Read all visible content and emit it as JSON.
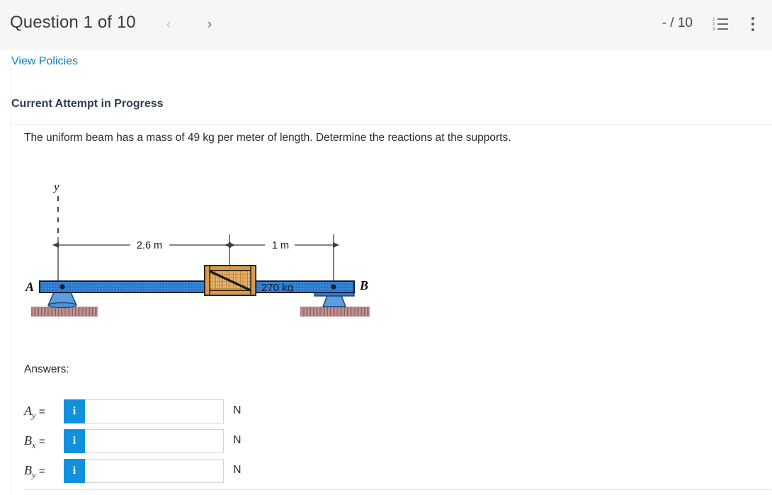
{
  "header": {
    "question_title": "Question 1 of 10",
    "prev_label": "‹",
    "next_label": "›",
    "score": "- / 10",
    "list_icon_name": "numbered-list-icon",
    "kebab_icon_name": "more-options-icon",
    "list_numbers": [
      "1",
      "2",
      "3"
    ],
    "background_color": "#f6f6f6"
  },
  "content": {
    "view_policies_label": "View Policies",
    "attempt_heading": "Current Attempt in Progress",
    "problem_statement": "The uniform beam has a mass of 49 kg per meter of length. Determine the reactions at the supports.",
    "answers_label": "Answers:",
    "link_color": "#0f7fbd",
    "accent_color": "#1191dd"
  },
  "figure": {
    "axis_label": "y",
    "dimension_left": "2.6 m",
    "dimension_right": "1 m",
    "crate_mass": "270 kg",
    "support_a_label": "A",
    "support_b_label": "B",
    "beam_color": "#2f7fd0",
    "ground_color": "#a87f7f",
    "crate_color": "#e0a95e"
  },
  "answers": [
    {
      "symbol": "A",
      "subscript": "y",
      "equals": "=",
      "value": "",
      "placeholder": "",
      "unit": "N",
      "info_label": "i"
    },
    {
      "symbol": "B",
      "subscript": "x",
      "equals": "=",
      "value": "",
      "placeholder": "",
      "unit": "N",
      "info_label": "i"
    },
    {
      "symbol": "B",
      "subscript": "y",
      "equals": "=",
      "value": "",
      "placeholder": "",
      "unit": "N",
      "info_label": "i"
    }
  ]
}
